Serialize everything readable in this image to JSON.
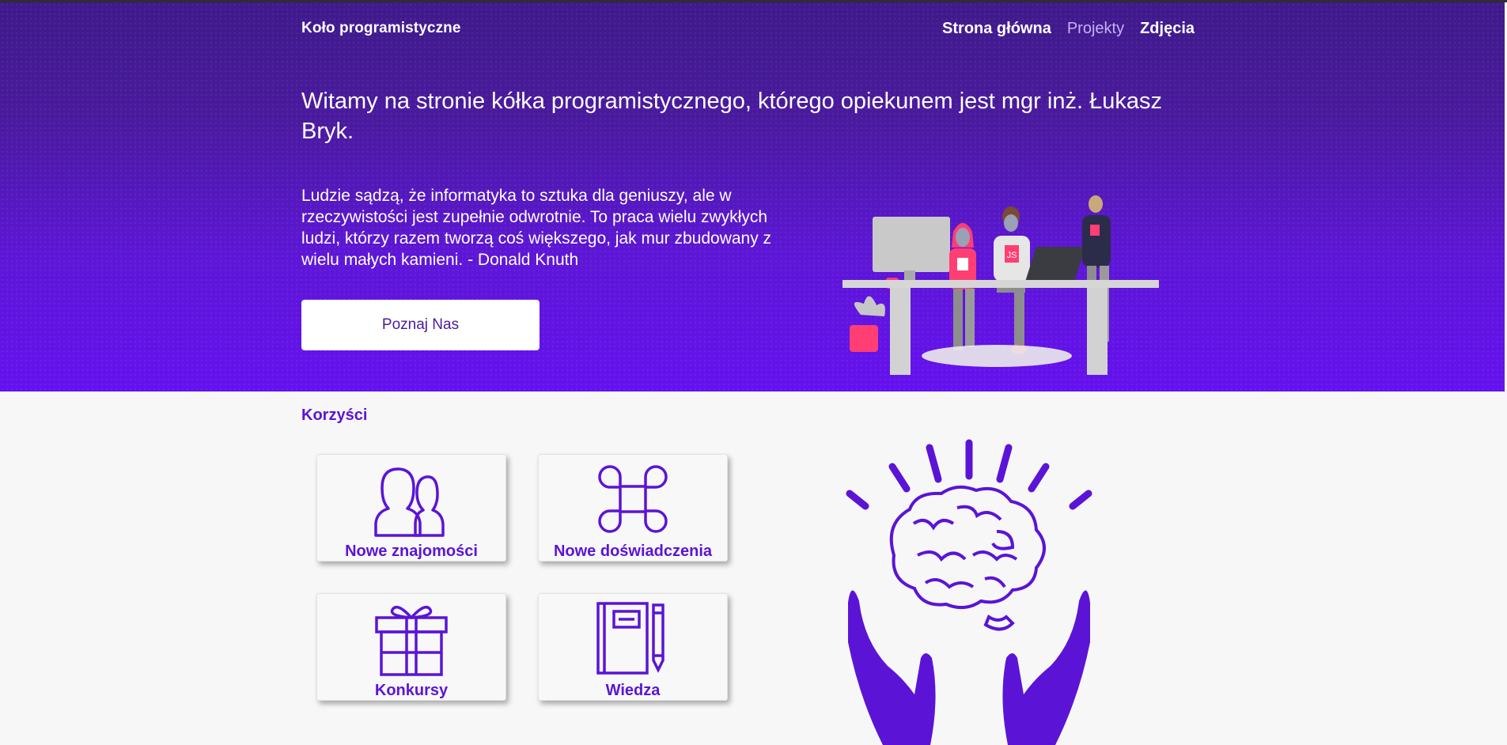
{
  "nav": {
    "brand": "Koło programistyczne",
    "links": [
      {
        "label": "Strona główna",
        "active": false
      },
      {
        "label": "Projekty",
        "active": true
      },
      {
        "label": "Zdjęcia",
        "active": false
      }
    ]
  },
  "hero": {
    "headline": "Witamy na stronie kółka programistycznego, którego opiekunem jest mgr inż. Łukasz Bryk.",
    "quote": "Ludzie sądzą, że informatyka to sztuka dla geniuszy, ale w rzeczywistości jest zupełnie odwrotnie. To praca wielu zwykłych ludzi, którzy razem tworzą coś większego, jak mur zbudowany z wielu małych kamieni. - Donald Knuth",
    "cta_label": "Poznaj Nas",
    "illustration_badges": [
      "JS"
    ]
  },
  "benefits": {
    "title": "Korzyści",
    "cards": [
      {
        "label": "Nowe znajomości",
        "icon": "people-icon"
      },
      {
        "label": "Nowe doświadczenia",
        "icon": "command-icon"
      },
      {
        "label": "Konkursy",
        "icon": "gift-icon"
      },
      {
        "label": "Wiedza",
        "icon": "notebook-icon"
      }
    ]
  },
  "colors": {
    "hero_top": "#3f1a8a",
    "hero_bottom": "#6511ee",
    "accent": "#5b14d6",
    "background": "#f7f7f7"
  }
}
